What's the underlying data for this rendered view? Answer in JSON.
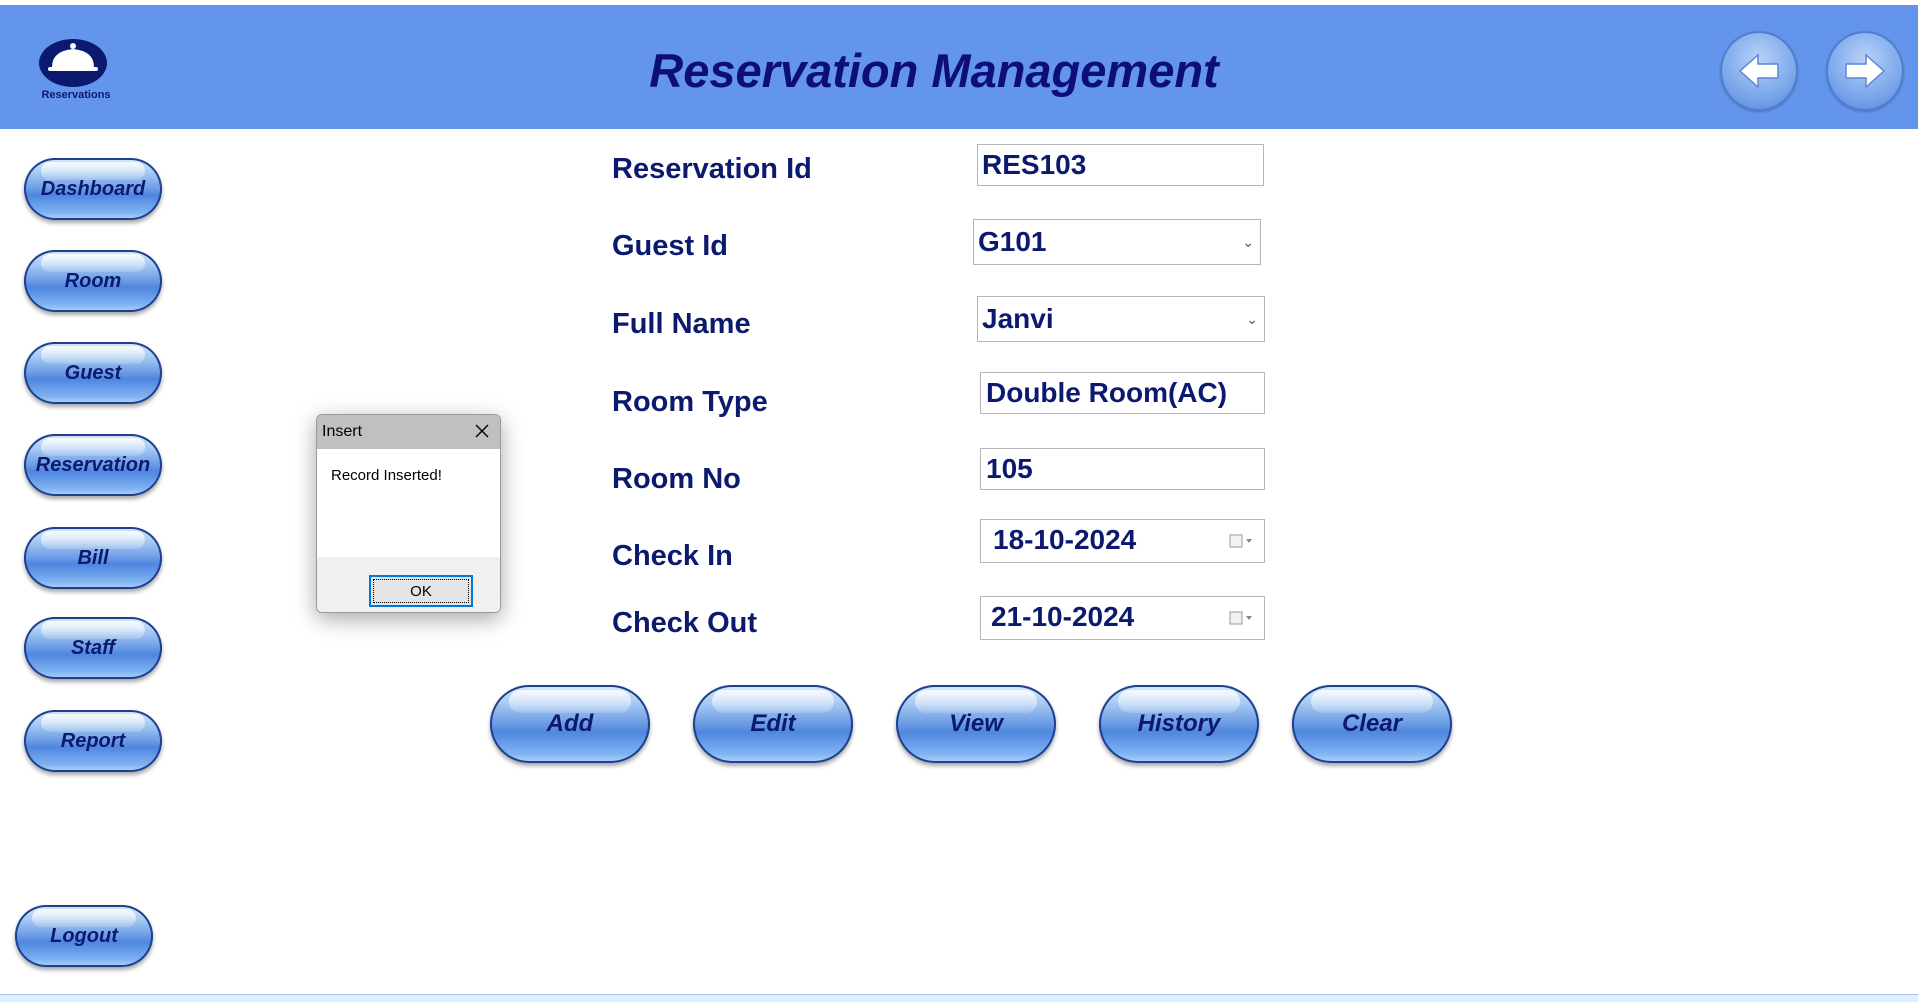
{
  "header": {
    "title": "Reservation Management",
    "logo_text": "Reservations",
    "back_icon": "arrow-left-icon",
    "forward_icon": "arrow-right-icon",
    "color": "#6495ED"
  },
  "sidebar": {
    "items": [
      {
        "label": "Dashboard"
      },
      {
        "label": "Room"
      },
      {
        "label": "Guest"
      },
      {
        "label": "Reservation"
      },
      {
        "label": "Bill"
      },
      {
        "label": "Staff"
      },
      {
        "label": "Report"
      }
    ],
    "logout_label": "Logout"
  },
  "form": {
    "reservation_id": {
      "label": "Reservation Id",
      "value": "RES103"
    },
    "guest_id": {
      "label": "Guest Id",
      "value": "G101"
    },
    "full_name": {
      "label": "Full Name",
      "value": "Janvi"
    },
    "room_type": {
      "label": "Room Type",
      "value": "Double Room(AC)"
    },
    "room_no": {
      "label": "Room No",
      "value": "105"
    },
    "check_in": {
      "label": "Check In",
      "value": "18-10-2024"
    },
    "check_out": {
      "label": "Check Out",
      "value": "21-10-2024"
    }
  },
  "actions": {
    "add": "Add",
    "edit": "Edit",
    "view": "View",
    "history": "History",
    "clear": "Clear"
  },
  "dialog": {
    "title": "Insert",
    "message": "Record Inserted!",
    "ok_label": "OK"
  }
}
